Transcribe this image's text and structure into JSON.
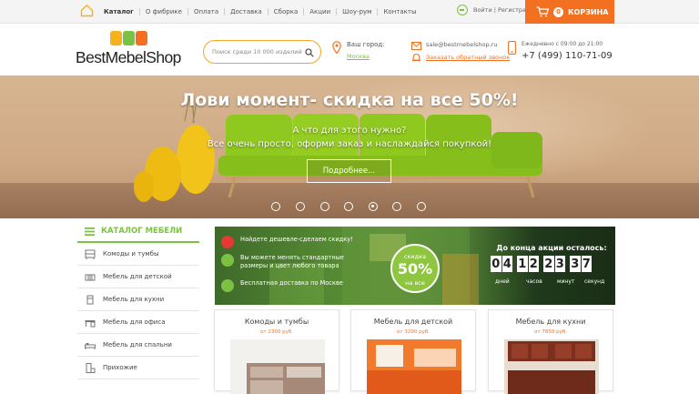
{
  "topbar": {
    "nav": [
      "Каталог",
      "О фибрике",
      "Оплата",
      "Доставка",
      "Сборка",
      "Акции",
      "Шоу-рум",
      "Контакты"
    ],
    "login": "Войти | Регистрация",
    "cart_count": "0",
    "cart_label": "КОРЗИНА",
    "cart_color": "#f37021"
  },
  "header": {
    "logo": "BestMebelShop",
    "search_placeholder": "Поиск среди 10 000 изделий",
    "city_label": "Ваш город:",
    "city_value": "Москва",
    "email": "sale@bestmebelshop.ru",
    "callback": "Заказать обратный звонок",
    "hours": "Ежедневно с 09:00 до 21:00",
    "phone": "+7 (499) 110-71-09"
  },
  "hero": {
    "title": "Лови момент- скидка на все 50%!",
    "line1": "А что для этого нужно?",
    "line2": "Все очень просто, оформи заказ и наслаждайся покупкой!",
    "button": "Подробнее...",
    "slides": 7,
    "active_slide": 5
  },
  "sidebar": {
    "title": "КАТАЛОГ МЕБЕЛИ",
    "items": [
      {
        "label": "Комоды и тумбы",
        "icon": "dresser-icon"
      },
      {
        "label": "Мебель для детской",
        "icon": "crib-icon"
      },
      {
        "label": "Мебель для кухни",
        "icon": "kitchen-icon"
      },
      {
        "label": "Мебель для офиса",
        "icon": "office-desk-icon"
      },
      {
        "label": "Мебель для спальни",
        "icon": "bed-icon"
      },
      {
        "label": "Прихожие",
        "icon": "hallway-icon"
      }
    ],
    "accent": "#7cc242"
  },
  "promo": {
    "items": [
      {
        "text": "Найдете дешевле-сделаем скидку!",
        "color": "#e53935"
      },
      {
        "text": "Вы можете менять стандартные размеры и цвет любого товара",
        "color": "#7cc242"
      },
      {
        "text": "Бесплатная доставка по Москве",
        "color": "#7cc242"
      }
    ],
    "badge_top": "скидка",
    "badge_value": "50%",
    "badge_bottom": "на все",
    "countdown_title": "До конца акции осталось:",
    "digits": [
      "0",
      "4",
      "1",
      "2",
      "2",
      "3",
      "3",
      "7"
    ],
    "units": [
      "дней",
      "часов",
      "минут",
      "секунд"
    ]
  },
  "products": [
    {
      "title": "Комоды и тумбы",
      "price": "от 2300 руб."
    },
    {
      "title": "Мебель для детской",
      "price": "от 3200 руб."
    },
    {
      "title": "Мебель для кухни",
      "price": "от 7850 руб."
    }
  ]
}
